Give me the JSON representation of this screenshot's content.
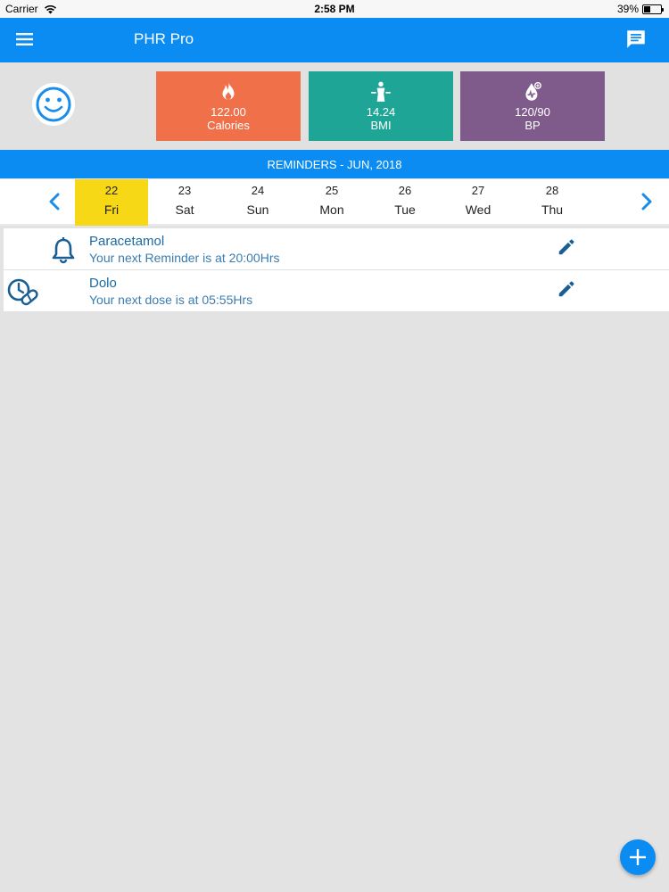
{
  "status_bar": {
    "carrier": "Carrier",
    "time": "2:58 PM",
    "battery": "39%",
    "battery_level": 0.39
  },
  "app_bar": {
    "title": "PHR Pro",
    "menu_icon": "hamburger-menu-icon",
    "chat_icon": "chat-message-icon"
  },
  "stats": {
    "avatar_icon": "smiley-face-icon",
    "tiles": [
      {
        "value": "122.00",
        "label": "Calories",
        "icon": "flame-icon",
        "color": "#f0704a"
      },
      {
        "value": "14.24",
        "label": "BMI",
        "icon": "body-scale-icon",
        "color": "#1ea596"
      },
      {
        "value": "120/90",
        "label": "BP",
        "icon": "blood-pressure-drop-icon",
        "color": "#7e5b8b"
      }
    ]
  },
  "reminders_header": "REMINDERS - JUN, 2018",
  "calendar": {
    "days": [
      {
        "num": "22",
        "name": "Fri",
        "selected": true
      },
      {
        "num": "23",
        "name": "Sat",
        "selected": false
      },
      {
        "num": "24",
        "name": "Sun",
        "selected": false
      },
      {
        "num": "25",
        "name": "Mon",
        "selected": false
      },
      {
        "num": "26",
        "name": "Tue",
        "selected": false
      },
      {
        "num": "27",
        "name": "Wed",
        "selected": false
      },
      {
        "num": "28",
        "name": "Thu",
        "selected": false
      }
    ],
    "selected_color": "#f7d816"
  },
  "reminders": [
    {
      "name": "Paracetamol",
      "subtitle": "Your next Reminder is at 20:00Hrs",
      "icon": "bell-icon"
    },
    {
      "name": "Dolo",
      "subtitle": "Your next dose is at 05:55Hrs",
      "icon": "pill-clock-icon"
    }
  ],
  "colors": {
    "primary": "#0a8cf3",
    "text_blue": "#1a6aa3"
  },
  "fab_icon": "plus-icon"
}
